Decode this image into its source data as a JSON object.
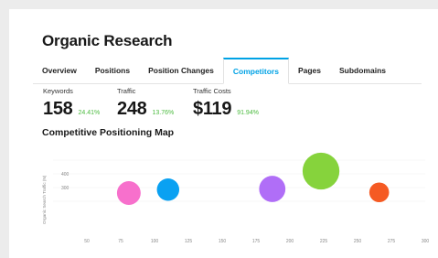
{
  "page": {
    "title": "Organic Research"
  },
  "tabs": [
    {
      "label": "Overview",
      "active": false
    },
    {
      "label": "Positions",
      "active": false
    },
    {
      "label": "Position Changes",
      "active": false
    },
    {
      "label": "Competitors",
      "active": true
    },
    {
      "label": "Pages",
      "active": false
    },
    {
      "label": "Subdomains",
      "active": false
    }
  ],
  "metrics": [
    {
      "label": "Keywords",
      "value": "158",
      "change": "24.41%"
    },
    {
      "label": "Traffic",
      "value": "248",
      "change": "13.76%"
    },
    {
      "label": "Traffic Costs",
      "value": "$119",
      "change": "91.94%"
    }
  ],
  "colors": {
    "accent": "#00a2e5",
    "positive": "#4cbb3f"
  },
  "chart_data": {
    "type": "scatter",
    "title": "Competitive Positioning Map",
    "ylabel": "Organic Search Traffic (N)",
    "xlabel": "",
    "xlim": [
      25,
      300
    ],
    "ylim": [
      0,
      600
    ],
    "x_ticks": [
      "50",
      "75",
      "100",
      "125",
      "150",
      "175",
      "200",
      "225",
      "250",
      "275",
      "300"
    ],
    "y_ticks": [
      "400",
      "300"
    ],
    "points": [
      {
        "x": 81,
        "y": 260,
        "size": 18,
        "color": "#f770cc"
      },
      {
        "x": 110,
        "y": 285,
        "size": 17,
        "color": "#0aa1f2"
      },
      {
        "x": 187,
        "y": 290,
        "size": 20,
        "color": "#b06ef7"
      },
      {
        "x": 223,
        "y": 420,
        "size": 28,
        "color": "#86d33c"
      },
      {
        "x": 266,
        "y": 265,
        "size": 15,
        "color": "#f55a23"
      }
    ]
  }
}
